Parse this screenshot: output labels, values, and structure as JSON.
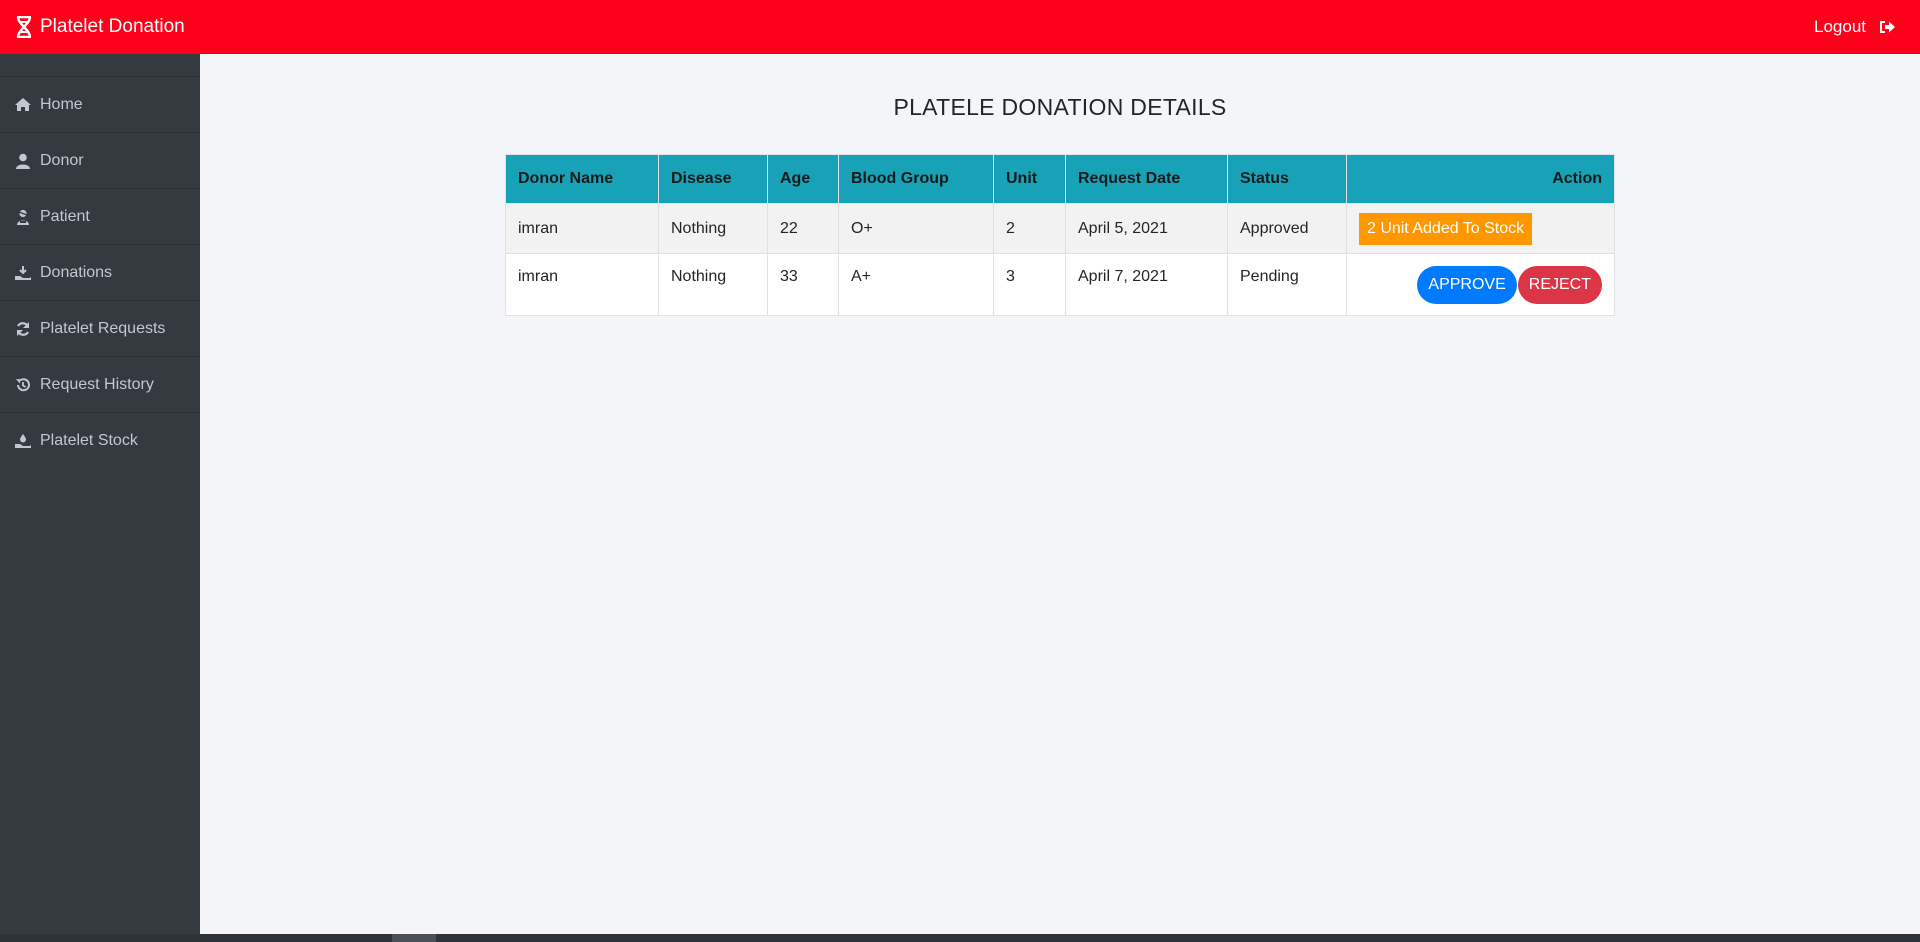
{
  "topbar": {
    "brand": "Platelet Donation",
    "brand_icon": "dna-icon",
    "logout_label": "Logout",
    "logout_icon": "sign-out-icon",
    "bg_color": "#ff001a"
  },
  "sidebar": {
    "items": [
      {
        "label": "Home",
        "icon": "home-icon"
      },
      {
        "label": "Donor",
        "icon": "user-icon"
      },
      {
        "label": "Patient",
        "icon": "user-injured-icon"
      },
      {
        "label": "Donations",
        "icon": "hand-holding-icon"
      },
      {
        "label": "Platelet Requests",
        "icon": "sync-icon"
      },
      {
        "label": "Request History",
        "icon": "history-icon"
      },
      {
        "label": "Platelet Stock",
        "icon": "hand-holding-medical-icon"
      }
    ]
  },
  "main": {
    "title": "PLATELE DONATION DETAILS",
    "table": {
      "headers": [
        "Donor Name",
        "Disease",
        "Age",
        "Blood Group",
        "Unit",
        "Request Date",
        "Status",
        "Action"
      ],
      "rows": [
        {
          "donor": "imran",
          "disease": "Nothing",
          "age": "22",
          "blood_group": "O+",
          "unit": "2",
          "date": "April 5, 2021",
          "status": "Approved",
          "action_text": "2 Unit Added To Stock"
        },
        {
          "donor": "imran",
          "disease": "Nothing",
          "age": "33",
          "blood_group": "A+",
          "unit": "3",
          "date": "April 7, 2021",
          "status": "Pending",
          "approve_label": "APPROVE",
          "reject_label": "REJECT"
        }
      ]
    }
  },
  "colors": {
    "header_bg": "#17a2b8",
    "approve": "#007bff",
    "reject": "#dc3545",
    "stock_badge": "#ff9800",
    "sidebar_bg": "#343a40"
  }
}
